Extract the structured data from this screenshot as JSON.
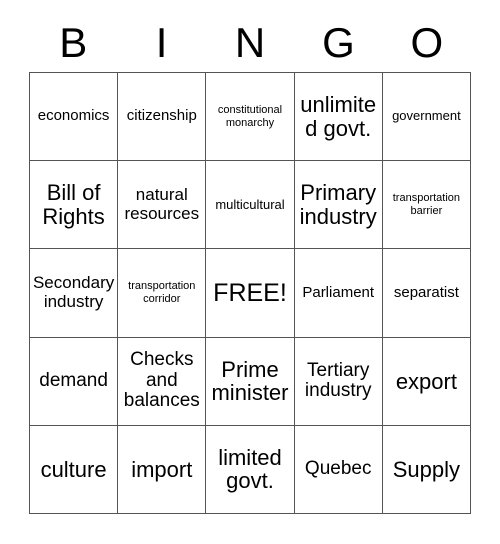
{
  "card": {
    "title": "Bingo Card",
    "header_letters": [
      "B",
      "I",
      "N",
      "G",
      "O"
    ],
    "columns": 5,
    "rows": 5,
    "free_space": "FREE!",
    "free_space_index": 12,
    "border_color": "#555555",
    "text_color": "#000000",
    "background_color": "#ffffff",
    "cells": [
      {
        "text": "economics",
        "size": "md"
      },
      {
        "text": "citizenship",
        "size": "md"
      },
      {
        "text": "constitutional monarchy",
        "size": "xs"
      },
      {
        "text": "unlimited govt.",
        "size": "xxl"
      },
      {
        "text": "government",
        "size": "sm"
      },
      {
        "text": "Bill of Rights",
        "size": "xxl"
      },
      {
        "text": "natural resources",
        "size": "lg"
      },
      {
        "text": "multicultural",
        "size": "sm"
      },
      {
        "text": "Primary industry",
        "size": "xxl"
      },
      {
        "text": "transportation barrier",
        "size": "xs"
      },
      {
        "text": "Secondary industry",
        "size": "lg"
      },
      {
        "text": "transportation corridor",
        "size": "xs"
      },
      {
        "text": "FREE!",
        "size": "free"
      },
      {
        "text": "Parliament",
        "size": "md"
      },
      {
        "text": "separatist",
        "size": "md"
      },
      {
        "text": "demand",
        "size": "xl"
      },
      {
        "text": "Checks and balances",
        "size": "xl"
      },
      {
        "text": "Prime minister",
        "size": "xxl"
      },
      {
        "text": "Tertiary industry",
        "size": "xl"
      },
      {
        "text": "export",
        "size": "xxl"
      },
      {
        "text": "culture",
        "size": "xxl"
      },
      {
        "text": "import",
        "size": "xxl"
      },
      {
        "text": "limited govt.",
        "size": "xxl"
      },
      {
        "text": "Quebec",
        "size": "xl"
      },
      {
        "text": "Supply",
        "size": "xxl"
      }
    ]
  }
}
